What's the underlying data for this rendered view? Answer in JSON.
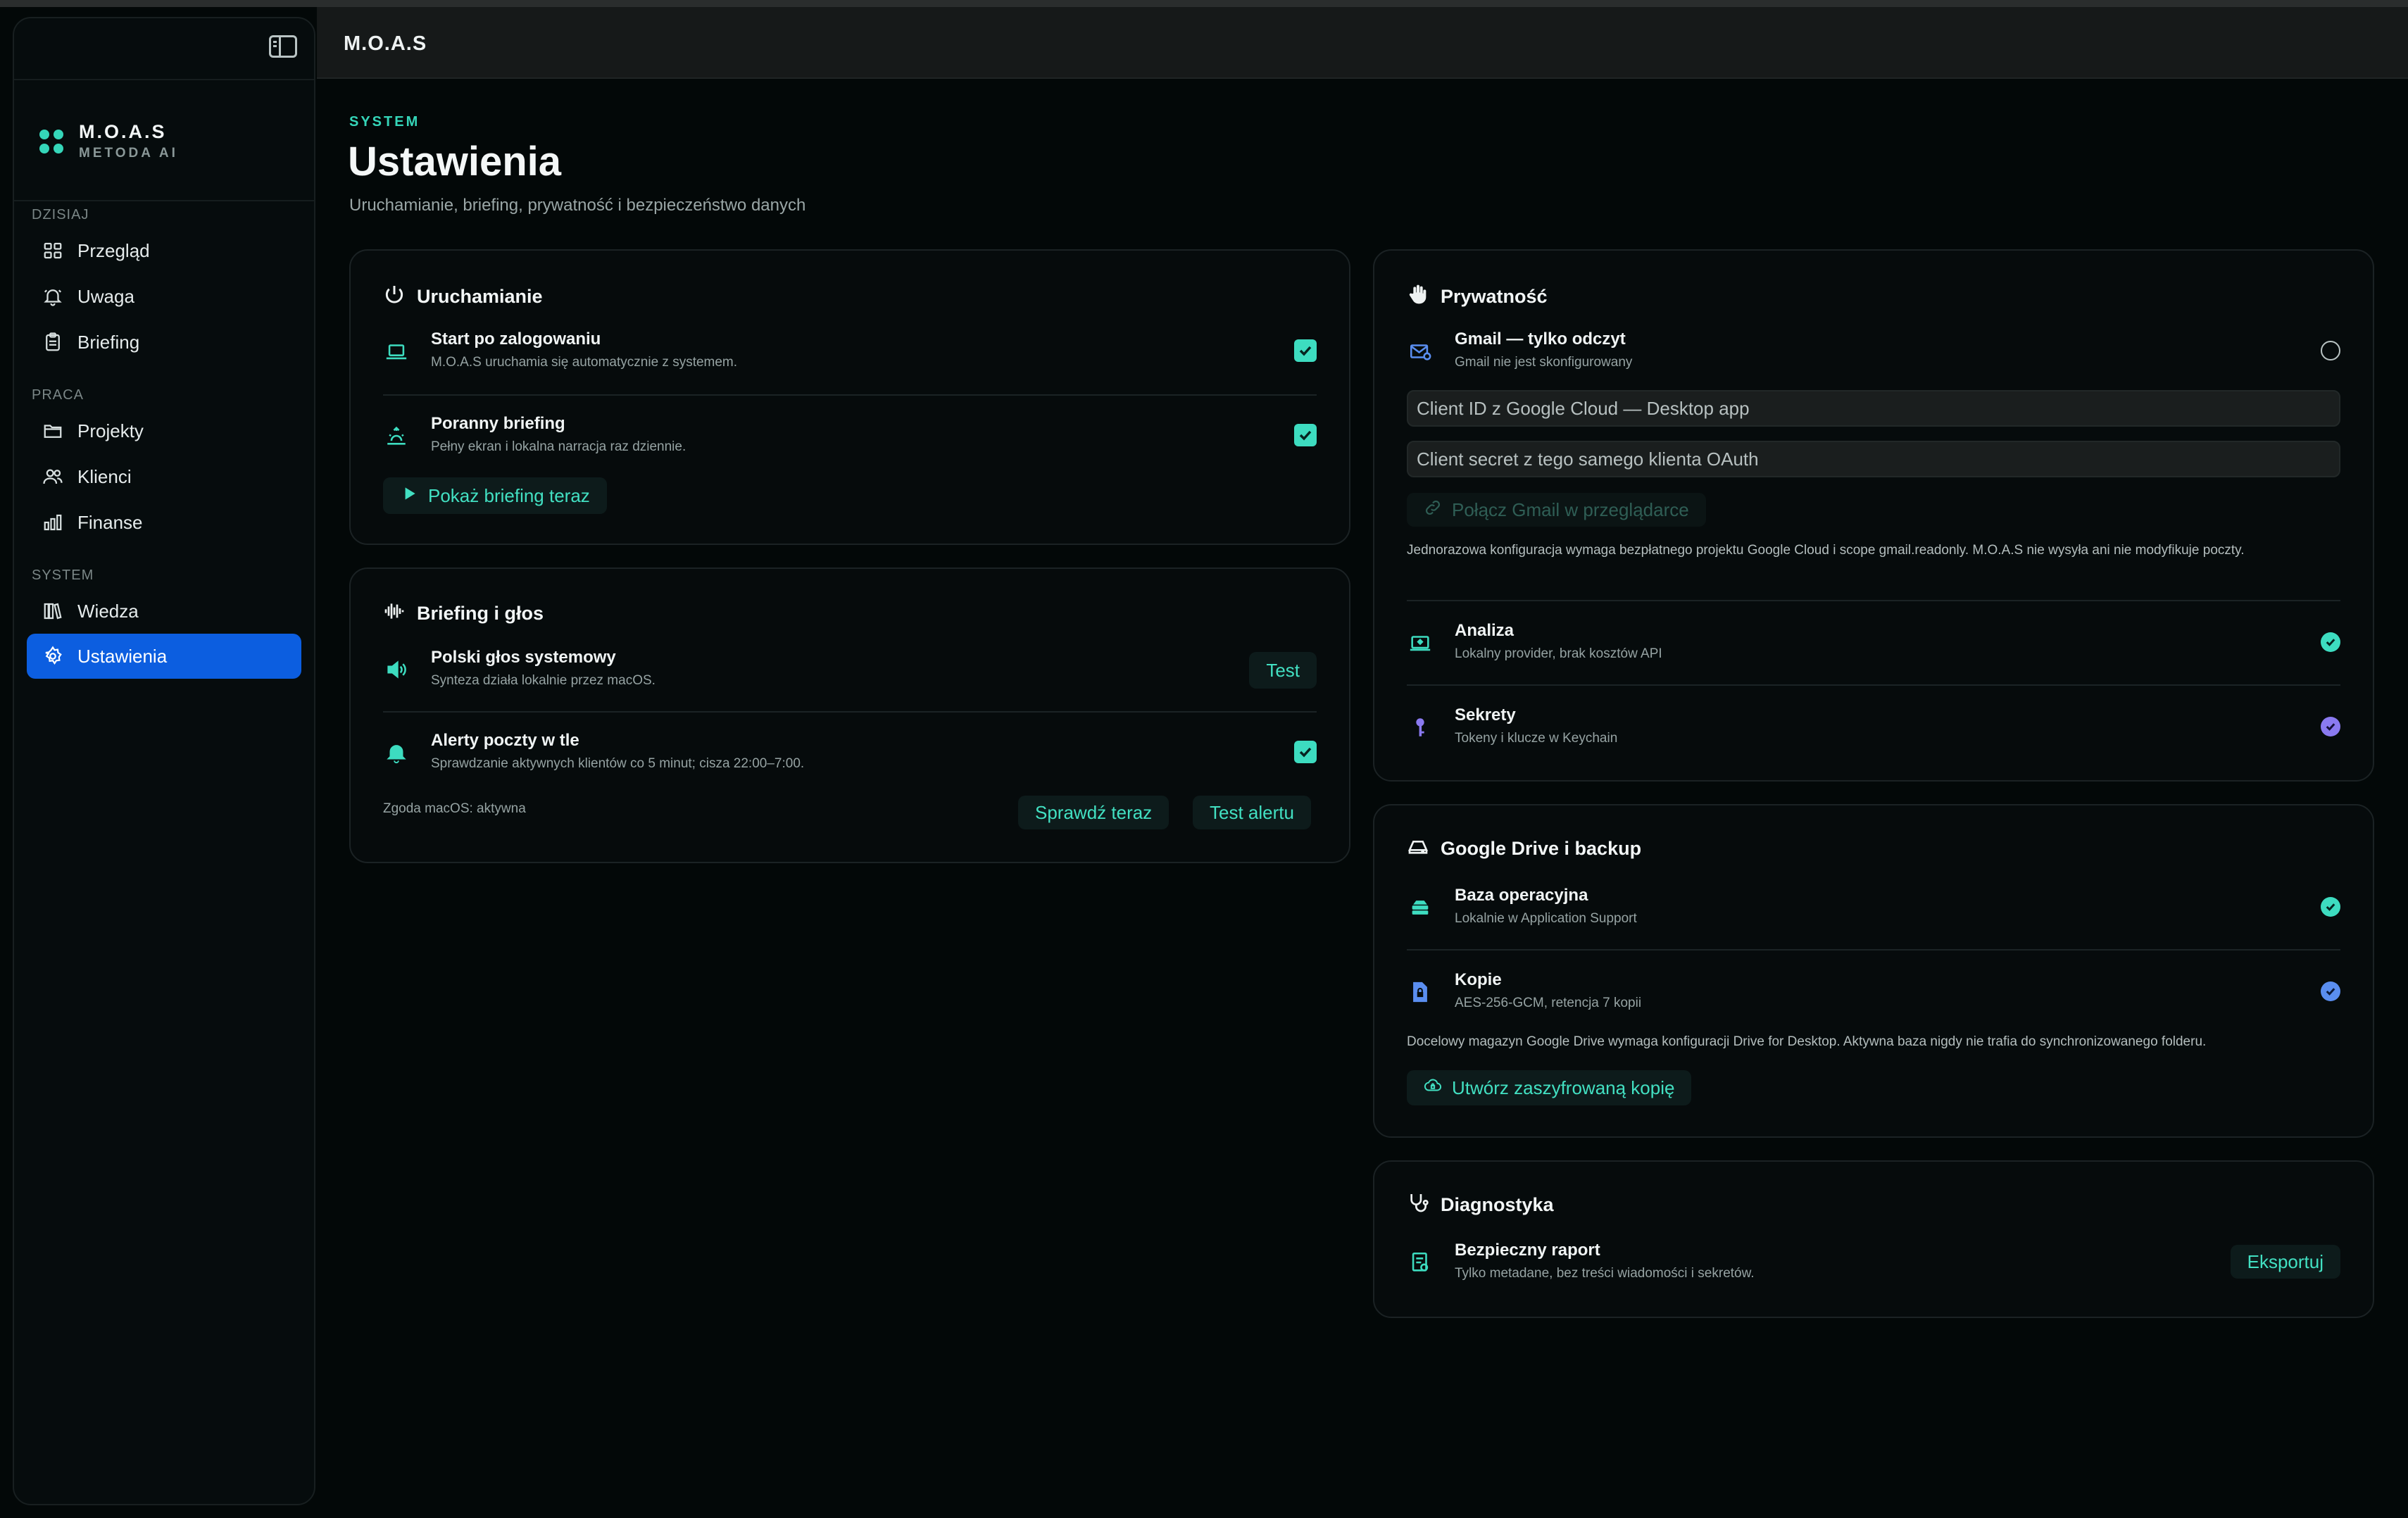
{
  "app": {
    "title": "M.O.A.S"
  },
  "sidebar": {
    "brand_name": "M.O.A.S",
    "brand_sub": "METODA AI",
    "sections": [
      {
        "label": "DZISIAJ",
        "items": [
          {
            "label": "Przegląd",
            "icon": "grid-icon"
          },
          {
            "label": "Uwaga",
            "icon": "bell-icon"
          },
          {
            "label": "Briefing",
            "icon": "clipboard-icon"
          }
        ]
      },
      {
        "label": "PRACA",
        "items": [
          {
            "label": "Projekty",
            "icon": "folder-icon"
          },
          {
            "label": "Klienci",
            "icon": "users-icon"
          },
          {
            "label": "Finanse",
            "icon": "bar-chart-icon"
          }
        ]
      },
      {
        "label": "SYSTEM",
        "items": [
          {
            "label": "Wiedza",
            "icon": "library-icon"
          },
          {
            "label": "Ustawienia",
            "icon": "gear-icon",
            "active": true
          }
        ]
      }
    ]
  },
  "page": {
    "eyebrow": "SYSTEM",
    "title": "Ustawienia",
    "subtitle": "Uruchamianie, briefing, prywatność i bezpieczeństwo danych"
  },
  "startup": {
    "title": "Uruchamianie",
    "rows": [
      {
        "title": "Start po zalogowaniu",
        "desc": "M.O.A.S uruchamia się automatycznie z systemem.",
        "checked": true
      },
      {
        "title": "Poranny briefing",
        "desc": "Pełny ekran i lokalna narracja raz dziennie.",
        "checked": true
      }
    ],
    "show_button": "Pokaż briefing teraz"
  },
  "voice": {
    "title": "Briefing i głos",
    "rows": [
      {
        "title": "Polski głos systemowy",
        "desc": "Synteza działa lokalnie przez macOS.",
        "button": "Test"
      },
      {
        "title": "Alerty poczty w tle",
        "desc": "Sprawdzanie aktywnych klientów co 5 minut; cisza 22:00–7:00.",
        "checked": true
      }
    ],
    "consent": "Zgoda macOS: aktywna",
    "check_now": "Sprawdź teraz",
    "test_alert": "Test alertu"
  },
  "privacy": {
    "title": "Prywatność",
    "gmail_title": "Gmail — tylko odczyt",
    "gmail_desc": "Gmail nie jest skonfigurowany",
    "client_id_placeholder": "Client ID z Google Cloud — Desktop app",
    "client_secret_placeholder": "Client secret z tego samego klienta OAuth",
    "connect_button": "Połącz Gmail w przeglądarce",
    "note": "Jednorazowa konfiguracja wymaga bezpłatnego projektu Google Cloud i scope gmail.readonly. M.O.A.S nie wysyła ani nie modyfikuje poczty.",
    "analysis_title": "Analiza",
    "analysis_desc": "Lokalny provider, brak kosztów API",
    "secrets_title": "Sekrety",
    "secrets_desc": "Tokeny i klucze w Keychain"
  },
  "drive": {
    "title": "Google Drive i backup",
    "db_title": "Baza operacyjna",
    "db_desc": "Lokalnie w Application Support",
    "copies_title": "Kopie",
    "copies_desc": "AES-256-GCM, retencja 7 kopii",
    "note": "Docelowy magazyn Google Drive wymaga konfiguracji Drive for Desktop. Aktywna baza nigdy nie trafia do synchronizowanego folderu.",
    "backup_button": "Utwórz zaszyfrowaną kopię"
  },
  "diagnostics": {
    "title": "Diagnostyka",
    "report_title": "Bezpieczny raport",
    "report_desc": "Tylko metadane, bez treści wiadomości i sekretów.",
    "export_button": "Eksportuj"
  },
  "colors": {
    "accent": "#35d6b9",
    "active_nav": "#0c5ee0",
    "ok_teal": "#3ddcc0",
    "ok_blue": "#5a8ef0",
    "ok_purple": "#8a7af0"
  }
}
